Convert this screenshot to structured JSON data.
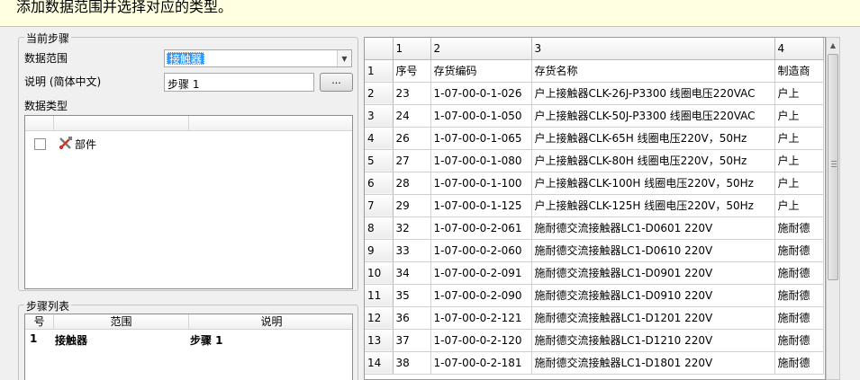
{
  "banner": {
    "text": "添加数据范围并选择对应的类型。"
  },
  "current_step": {
    "title": "当前步骤",
    "range_label": "数据范围",
    "range_value": "接触器",
    "desc_label": "说明 (简体中文)",
    "desc_value": "步骤 1",
    "browse_label": "...",
    "type_label": "数据类型",
    "types": [
      {
        "label": "部件",
        "icon": "tool-icon",
        "checked": false
      }
    ]
  },
  "step_list": {
    "title": "步骤列表",
    "columns": [
      "号",
      "范围",
      "说明"
    ],
    "rows": [
      {
        "num": "1",
        "range": "接触器",
        "desc": "步骤 1"
      }
    ]
  },
  "grid": {
    "column_headers": [
      "1",
      "2",
      "3",
      "4"
    ],
    "rows": [
      {
        "rh": "1",
        "c1": "序号",
        "c2": "存货编码",
        "c3": "存货名称",
        "c4": "制造商"
      },
      {
        "rh": "2",
        "c1": "23",
        "c2": "1-07-00-0-1-026",
        "c3": "户上接触器CLK-26J-P3300  线圈电压220VAC",
        "c4": "户上"
      },
      {
        "rh": "3",
        "c1": "24",
        "c2": "1-07-00-0-1-050",
        "c3": "户上接触器CLK-50J-P3300  线圈电压220VAC",
        "c4": "户上"
      },
      {
        "rh": "4",
        "c1": "26",
        "c2": "1-07-00-0-1-065",
        "c3": "户上接触器CLK-65H     线圈电压220V，50Hz",
        "c4": "户上"
      },
      {
        "rh": "5",
        "c1": "27",
        "c2": "1-07-00-0-1-080",
        "c3": "户上接触器CLK-80H     线圈电压220V，50Hz",
        "c4": "户上"
      },
      {
        "rh": "6",
        "c1": "28",
        "c2": "1-07-00-0-1-100",
        "c3": "户上接触器CLK-100H     线圈电压220V，50Hz",
        "c4": "户上"
      },
      {
        "rh": "7",
        "c1": "29",
        "c2": "1-07-00-0-1-125",
        "c3": "户上接触器CLK-125H     线圈电压220V，50Hz",
        "c4": "户上"
      },
      {
        "rh": "8",
        "c1": "32",
        "c2": "1-07-00-0-2-061",
        "c3": "施耐德交流接触器LC1-D0601 220V",
        "c4": "施耐德"
      },
      {
        "rh": "9",
        "c1": "33",
        "c2": "1-07-00-0-2-060",
        "c3": "施耐德交流接触器LC1-D0610 220V",
        "c4": "施耐德"
      },
      {
        "rh": "10",
        "c1": "34",
        "c2": "1-07-00-0-2-091",
        "c3": "施耐德交流接触器LC1-D0901 220V",
        "c4": "施耐德"
      },
      {
        "rh": "11",
        "c1": "35",
        "c2": "1-07-00-0-2-090",
        "c3": "施耐德交流接触器LC1-D0910 220V",
        "c4": "施耐德"
      },
      {
        "rh": "12",
        "c1": "36",
        "c2": "1-07-00-0-2-121",
        "c3": "施耐德交流接触器LC1-D1201 220V",
        "c4": "施耐德"
      },
      {
        "rh": "13",
        "c1": "37",
        "c2": "1-07-00-0-2-120",
        "c3": "施耐德交流接触器LC1-D1210 220V",
        "c4": "施耐德"
      },
      {
        "rh": "14",
        "c1": "38",
        "c2": "1-07-00-0-2-181",
        "c3": "施耐德交流接触器LC1-D1801 220V",
        "c4": "施耐德"
      }
    ]
  }
}
